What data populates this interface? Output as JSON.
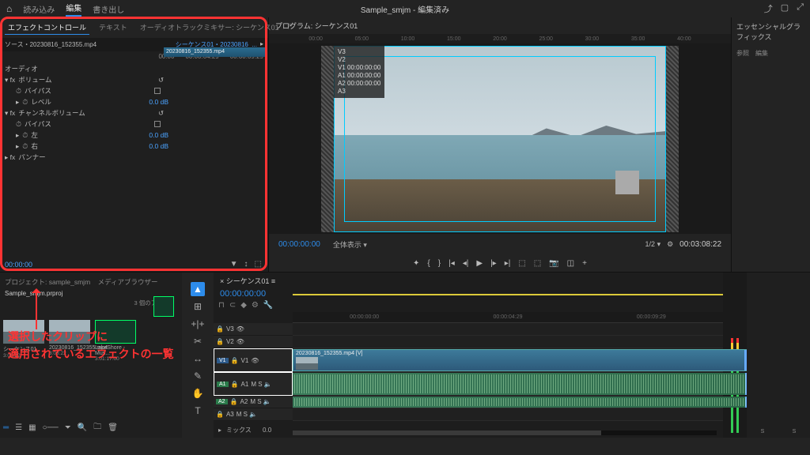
{
  "topbar": {
    "workspaces": [
      "読み込み",
      "編集",
      "書き出し"
    ],
    "title": "Sample_smjm - 編集済み"
  },
  "source_panel": {
    "tabs": [
      "エフェクトコントロール",
      "テキスト",
      "オーディオトラックミキサー: シーケンス01"
    ],
    "source_clip": "ソース・20230816_152355.mp4",
    "sequence_ref": "シーケンス01・20230816_...",
    "ruler": [
      "00:00",
      "00:00:04:29",
      "00:00:09:29"
    ],
    "seq_strip": "20230816_152355.mp4",
    "section": "オーディオ",
    "effects": {
      "volume": {
        "name": "ボリューム",
        "bypass": "バイパス",
        "level": "レベル",
        "level_val": "0.0 dB"
      },
      "chanvol": {
        "name": "チャンネルボリューム",
        "bypass": "バイパス",
        "left": "左",
        "right": "右",
        "val": "0.0 dB"
      },
      "panner": "パンナー"
    },
    "foot_tc": "00:00:00"
  },
  "program": {
    "tab": "プログラム: シーケンス01",
    "ruler": [
      "00:00",
      "05:00",
      "10:00",
      "15:00",
      "20:00",
      "25:00",
      "30:00",
      "35:00",
      "40:00"
    ],
    "overlay": [
      "V3",
      "V2",
      "V1 00:00:00:00",
      "A1 00:00:00:00",
      "A2 00:00:00:00",
      "A3"
    ],
    "current_tc": "00:00:00:00",
    "fit": "全体表示",
    "half": "1/2",
    "duration": "00:03:08:22"
  },
  "right_panel": {
    "title": "エッセンシャルグラフィックス",
    "subtabs": [
      "参照",
      "編集"
    ]
  },
  "project": {
    "tab": "プロジェクト: sample_smjm",
    "tab2": "メディアブラウザー",
    "file": "Sample_smjm.prproj",
    "items_label": "3 個のアイテム",
    "thumbs": [
      {
        "name": "シーケンス01",
        "dur": "3:08:22"
      },
      {
        "name": "20230816_152355.mp4",
        "dur": "3:08:22"
      },
      {
        "name": "LakeShore - Mus...",
        "dur": "3:01:17:00"
      }
    ]
  },
  "annotation": {
    "line1": "選択したクリップに",
    "line2": "適用されているエフェクトの一覧"
  },
  "timeline": {
    "seq_name": "シーケンス01",
    "tc": "00:00:00:00",
    "ruler": [
      "00:00:00:00",
      "00:00:04:29",
      "00:00:09:29"
    ],
    "tracks_v": [
      "V3",
      "V2",
      "V1"
    ],
    "tracks_a": [
      "A1",
      "A2",
      "A3"
    ],
    "clip_label": "20230816_152355.mp4 [V]",
    "mix": "ミックス",
    "mix_val": "0.0"
  },
  "eq": {
    "s_left": "S",
    "s_right": "S"
  }
}
